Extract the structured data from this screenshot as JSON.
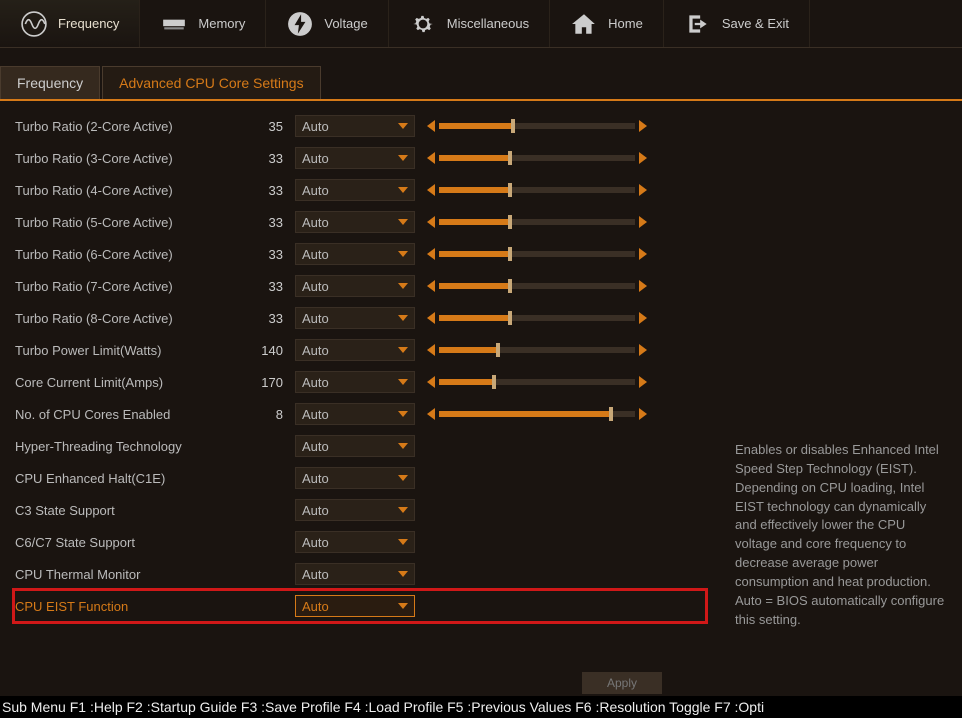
{
  "nav": {
    "frequency": "Frequency",
    "memory": "Memory",
    "voltage": "Voltage",
    "misc": "Miscellaneous",
    "home": "Home",
    "save_exit": "Save & Exit"
  },
  "tabs": {
    "frequency": "Frequency",
    "advanced": "Advanced CPU Core Settings"
  },
  "settings": [
    {
      "label": "Turbo Ratio (2-Core Active)",
      "value": "35",
      "option": "Auto",
      "slider": 38
    },
    {
      "label": "Turbo Ratio (3-Core Active)",
      "value": "33",
      "option": "Auto",
      "slider": 36
    },
    {
      "label": "Turbo Ratio (4-Core Active)",
      "value": "33",
      "option": "Auto",
      "slider": 36
    },
    {
      "label": "Turbo Ratio (5-Core Active)",
      "value": "33",
      "option": "Auto",
      "slider": 36
    },
    {
      "label": "Turbo Ratio (6-Core Active)",
      "value": "33",
      "option": "Auto",
      "slider": 36
    },
    {
      "label": "Turbo Ratio (7-Core Active)",
      "value": "33",
      "option": "Auto",
      "slider": 36
    },
    {
      "label": "Turbo Ratio (8-Core Active)",
      "value": "33",
      "option": "Auto",
      "slider": 36
    },
    {
      "label": "Turbo Power Limit(Watts)",
      "value": "140",
      "option": "Auto",
      "slider": 30
    },
    {
      "label": "Core Current Limit(Amps)",
      "value": "170",
      "option": "Auto",
      "slider": 28
    },
    {
      "label": "No. of CPU Cores Enabled",
      "value": "8",
      "option": "Auto",
      "slider": 88
    },
    {
      "label": "Hyper-Threading Technology",
      "value": "",
      "option": "Auto",
      "slider": null
    },
    {
      "label": "CPU Enhanced Halt(C1E)",
      "value": "",
      "option": "Auto",
      "slider": null
    },
    {
      "label": "C3 State Support",
      "value": "",
      "option": "Auto",
      "slider": null
    },
    {
      "label": "C6/C7 State Support",
      "value": "",
      "option": "Auto",
      "slider": null
    },
    {
      "label": "CPU Thermal Monitor",
      "value": "",
      "option": "Auto",
      "slider": null
    },
    {
      "label": "CPU EIST Function",
      "value": "",
      "option": "Auto",
      "slider": null,
      "highlight": true
    }
  ],
  "help_text": "Enables or disables Enhanced Intel Speed Step Technology (EIST). Depending on CPU loading, Intel EIST technology can dynamically and effectively lower the CPU voltage and core frequency to decrease average power consumption and heat production.\nAuto = BIOS automatically configure this setting.",
  "apply_label": "Apply",
  "footer": "Sub Menu F1 :Help F2 :Startup Guide F3 :Save Profile F4 :Load Profile F5 :Previous Values F6 :Resolution Toggle F7 :Opti"
}
